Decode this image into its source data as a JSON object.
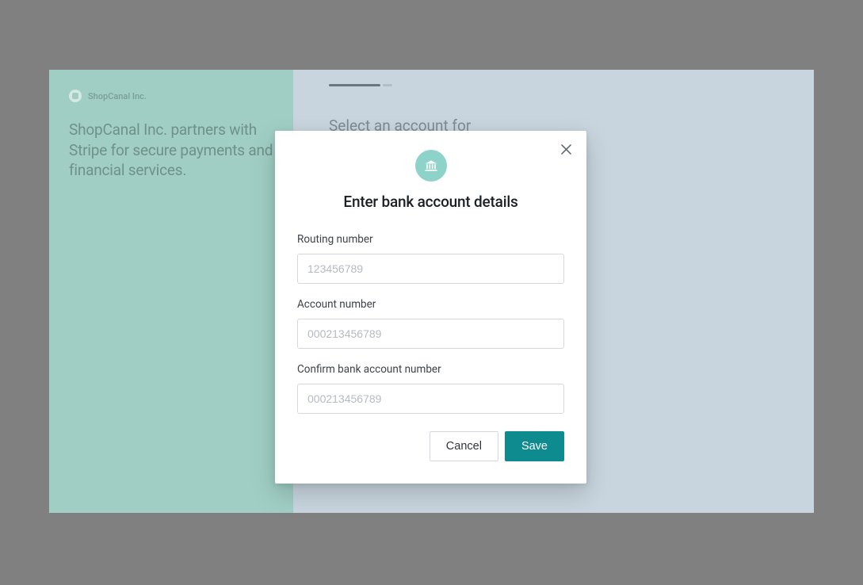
{
  "sidebar": {
    "company": "ShopCanal Inc.",
    "headline": "ShopCanal Inc. partners with Stripe for secure payments and financial services."
  },
  "main": {
    "title": "Select an account for"
  },
  "modal": {
    "title": "Enter bank account details",
    "fields": {
      "routing": {
        "label": "Routing number",
        "placeholder": "123456789"
      },
      "account": {
        "label": "Account number",
        "placeholder": "000213456789"
      },
      "confirm": {
        "label": "Confirm bank account number",
        "placeholder": "000213456789"
      }
    },
    "buttons": {
      "cancel": "Cancel",
      "save": "Save"
    },
    "colors": {
      "iconBg": "#8ed3ca",
      "primary": "#0d8b8f"
    }
  }
}
